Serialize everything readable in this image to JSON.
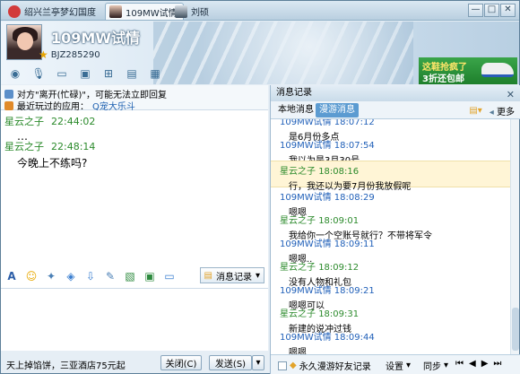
{
  "tabs": [
    {
      "label": "绍兴兰亭梦幻国度",
      "icon": "heart-icon"
    },
    {
      "label": "109MW试情",
      "icon": "avatar-icon"
    },
    {
      "label": "刘硕",
      "icon": "avatar-icon"
    }
  ],
  "window_buttons": {
    "minimize": "—",
    "maximize": "□",
    "close": "✕"
  },
  "contact": {
    "name": "109MW试情",
    "id": "BJZ285290"
  },
  "ad": {
    "line1": "这鞋抢疯了",
    "line2": "3折还包邮"
  },
  "notice": {
    "line1": "对方\"离开(忙碌)\"，可能无法立即回复",
    "line2_prefix": "最近玩过的应用：",
    "line2_link": "Q宠大乐斗"
  },
  "chat": [
    {
      "sender": "星云之子",
      "time": "22:44:02",
      "text": "…"
    },
    {
      "sender": "星云之子",
      "time": "22:48:14",
      "text": "今晚上不练吗?"
    }
  ],
  "input_toolbar": {
    "history_button": "消息记录"
  },
  "footer": {
    "status": "天上掉馅饼，三亚酒店75元起",
    "close_button": "关闭(C)",
    "send_button": "发送(S)"
  },
  "history": {
    "title": "消息记录",
    "tab_local": "本地消息",
    "tab_roam": "漫游消息",
    "more": "更多",
    "entries": [
      {
        "who": "109MW试情",
        "time": "18:07:12",
        "text": "是6月份多点",
        "me": false,
        "hl": false
      },
      {
        "who": "109MW试情",
        "time": "18:07:54",
        "text": "我以为是3月30号",
        "me": false,
        "hl": false
      },
      {
        "who": "星云之子",
        "time": "18:08:16",
        "text": "行，我还以为要7月份我放假呢",
        "me": true,
        "hl": true
      },
      {
        "who": "109MW试情",
        "time": "18:08:29",
        "text": "嗯嗯",
        "me": false,
        "hl": false
      },
      {
        "who": "星云之子",
        "time": "18:09:01",
        "text": "我给你一个空账号就行？不带将军令",
        "me": true,
        "hl": false
      },
      {
        "who": "109MW试情",
        "time": "18:09:11",
        "text": "嗯嗯..",
        "me": false,
        "hl": false
      },
      {
        "who": "星云之子",
        "time": "18:09:12",
        "text": "没有人物和礼包",
        "me": true,
        "hl": false
      },
      {
        "who": "109MW试情",
        "time": "18:09:21",
        "text": "嗯嗯可以",
        "me": false,
        "hl": false
      },
      {
        "who": "星云之子",
        "time": "18:09:31",
        "text": "新建的说冲过钱",
        "me": true,
        "hl": false
      },
      {
        "who": "109MW试情",
        "time": "18:09:44",
        "text": "嗯嗯",
        "me": false,
        "hl": false
      }
    ],
    "footer_roam": "永久漫游好友记录",
    "footer_settings": "设置",
    "footer_sync": "同步"
  }
}
